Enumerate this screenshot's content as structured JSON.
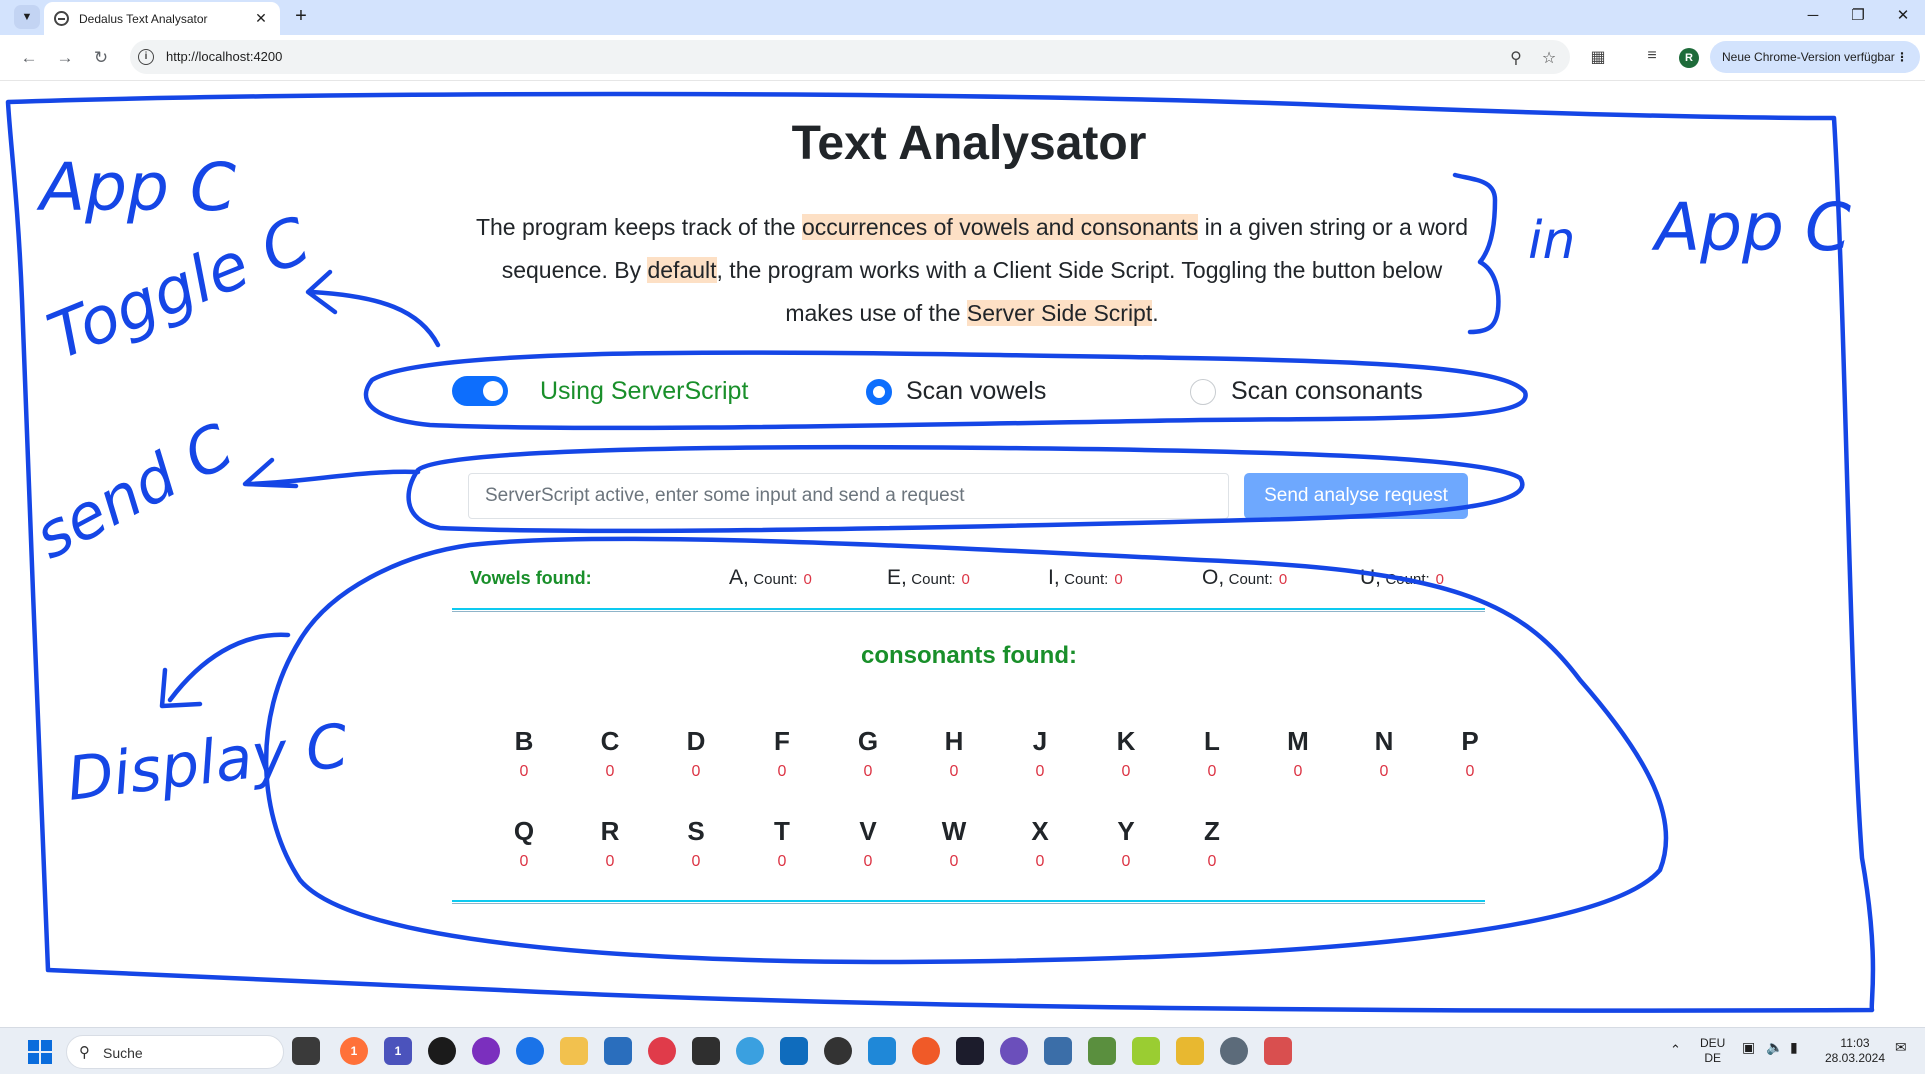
{
  "browser": {
    "tab_title": "Dedalus Text Analysator",
    "tab_close": "✕",
    "new_tab": "+",
    "url": "http://localhost:4200",
    "update_label": "Neue Chrome-Version verfügbar",
    "profile_initial": "R",
    "window_controls": {
      "minimize": "─",
      "restore": "❐",
      "close": "✕"
    }
  },
  "app": {
    "title": "Text Analysator",
    "description": {
      "p1": "The program keeps track of the ",
      "h1": "occurrences of vowels and consonants",
      "p2": " in a given string or a word sequence. By ",
      "h2": "default",
      "p3": ", the program works with a Client Side Script. Toggling the button below makes use of the ",
      "h3": "Server Side Script",
      "p4": "."
    },
    "toggle": {
      "label": "Using ServerScript",
      "on": true,
      "accent": "#0d6efd"
    },
    "radios": [
      {
        "label": "Scan vowels",
        "checked": true
      },
      {
        "label": "Scan consonants",
        "checked": false
      }
    ],
    "request": {
      "placeholder": "ServerScript active, enter some input and send a request",
      "value": "",
      "button_label": "Send analyse request"
    },
    "vowels": {
      "label": "Vowels found:",
      "count_label": "Count:",
      "items": [
        {
          "letter": "A,",
          "count": "0"
        },
        {
          "letter": "E,",
          "count": "0"
        },
        {
          "letter": "I,",
          "count": "0"
        },
        {
          "letter": "O,",
          "count": "0"
        },
        {
          "letter": "U,",
          "count": "0"
        }
      ]
    },
    "consonants": {
      "label": "consonants found:",
      "row1": [
        {
          "letter": "B",
          "count": "0"
        },
        {
          "letter": "C",
          "count": "0"
        },
        {
          "letter": "D",
          "count": "0"
        },
        {
          "letter": "F",
          "count": "0"
        },
        {
          "letter": "G",
          "count": "0"
        },
        {
          "letter": "H",
          "count": "0"
        },
        {
          "letter": "J",
          "count": "0"
        },
        {
          "letter": "K",
          "count": "0"
        },
        {
          "letter": "L",
          "count": "0"
        },
        {
          "letter": "M",
          "count": "0"
        },
        {
          "letter": "N",
          "count": "0"
        },
        {
          "letter": "P",
          "count": "0"
        }
      ],
      "row2": [
        {
          "letter": "Q",
          "count": "0"
        },
        {
          "letter": "R",
          "count": "0"
        },
        {
          "letter": "S",
          "count": "0"
        },
        {
          "letter": "T",
          "count": "0"
        },
        {
          "letter": "V",
          "count": "0"
        },
        {
          "letter": "W",
          "count": "0"
        },
        {
          "letter": "X",
          "count": "0"
        },
        {
          "letter": "Y",
          "count": "0"
        },
        {
          "letter": "Z",
          "count": "0"
        }
      ]
    },
    "colors": {
      "green": "#198f2a",
      "red": "#dc3545",
      "highlight": "#fde0c5",
      "button": "#6ea8fe"
    }
  },
  "annotations": {
    "app_c": "App C",
    "toggle_c": "Toggle C",
    "send_c": "send C",
    "display_c": "Display C",
    "in_app_c_prefix": "in",
    "in_app_c": "App C",
    "ink_color": "#1546e6"
  },
  "taskbar": {
    "search_label": "Suche",
    "language": "DEU",
    "region": "DE",
    "time": "11:03",
    "date": "28.03.2024",
    "badges": {
      "firefox": "1",
      "teams": "1"
    }
  }
}
